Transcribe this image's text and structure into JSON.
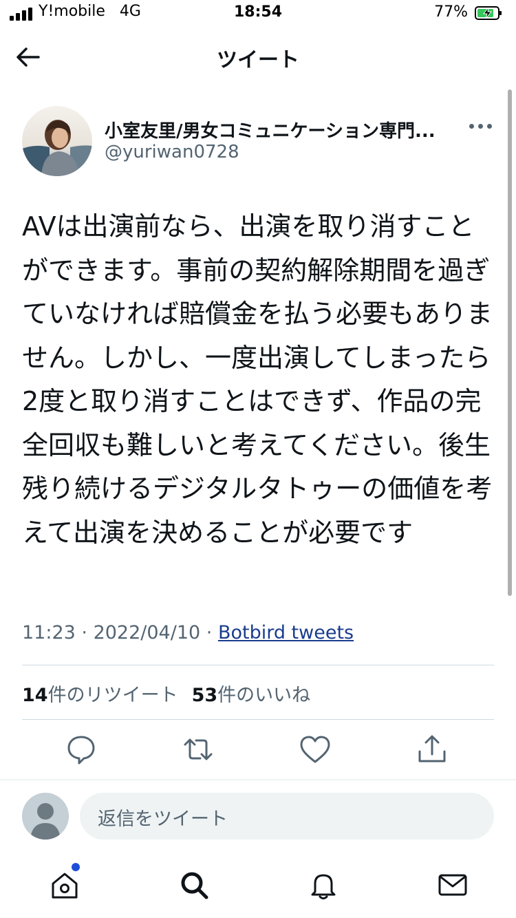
{
  "status_bar": {
    "carrier": "Y!mobile",
    "network": "4G",
    "time": "18:54",
    "battery_percent": "77%"
  },
  "nav": {
    "title": "ツイート",
    "back_icon": "arrow-left-icon"
  },
  "tweet": {
    "author_name": "小室友里/男女コミュニケーション専門...",
    "author_handle": "@yuriwan0728",
    "body": "AVは出演前なら、出演を取り消すことができます。事前の契約解除期間を過ぎていなければ賠償金を払う必要もありません。しかし、一度出演してしまったら2度と取り消すことはできず、作品の完全回収も難しいと考えてください。後生残り続けるデジタルタトゥーの価値を考えて出演を決めることが必要です",
    "time": "11:23",
    "date": "2022/04/10",
    "source": "Botbird tweets",
    "retweets_count": "14",
    "retweets_label": "件のリツイート",
    "likes_count": "53",
    "likes_label": "件のいいね"
  },
  "actions": [
    "reply-icon",
    "retweet-icon",
    "like-icon",
    "share-icon"
  ],
  "reply": {
    "placeholder": "返信をツイート"
  },
  "tab_bar": [
    "home-icon",
    "search-icon",
    "notifications-icon",
    "messages-icon"
  ],
  "colors": {
    "text": "#0f1419",
    "secondary": "#536471",
    "link": "#1a3c8f",
    "accent": "#1d4ed8",
    "battery_green": "#34c759"
  }
}
